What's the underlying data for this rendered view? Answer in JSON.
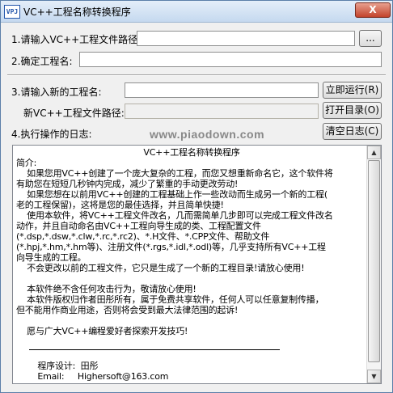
{
  "window": {
    "icon_text": "VPJ",
    "title": "VC++工程名称转换程序",
    "close_label": "X"
  },
  "form": {
    "path_label": "1.请输入VC++工程文件路径:",
    "path_value": "",
    "browse_label": "...",
    "confirm_label": "2.确定工程名:",
    "confirm_value": "",
    "new_name_label": "3.请输入新的工程名:",
    "new_name_value": "",
    "run_label": "立即运行(R)",
    "new_path_label": "新VC++工程文件路径:",
    "new_path_value": "",
    "open_dir_label": "打开目录(O)",
    "log_label": "4.执行操作的日志:",
    "clear_log_label": "清空日志(C)"
  },
  "watermark": "www.piaodown.com",
  "log": {
    "heading": "VC++工程名称转换程序",
    "lines": [
      "简介:",
      "    如果您用VC++创建了一个庞大复杂的工程，而您又想重新命名它，这个软件将",
      "有助您在短短几秒钟内完成，减少了繁重的手动更改劳动!",
      "    如果您想在以前用VC++创建的工程基础上作一些改动而生成另一个新的工程(",
      "老的工程保留)，这将是您的最佳选择，并且简单快捷!",
      "    使用本软件，将VC++工程文件改名，几而需简单几步即可以完成工程文件改名",
      "动作，并且自动命名由VC++工程向导生成的类、工程配置文件",
      "(*.dsp,*.dsw,*.clw,*.rc,*.rc2)、*.H文件、*.CPP文件、帮助文件",
      "(*.hpj,*.hm,*.hm等)、注册文件(*.rgs,*.idl,*.odl)等，几乎支持所有VC++工程",
      "向导生成的工程。",
      "    不会更改以前的工程文件，它只是生成了一个新的工程目录!请放心使用!",
      "",
      "    本软件绝不含任何攻击行为，敬请放心使用!",
      "    本软件版权归作者田彤所有，属于免费共享软件，任何人可以任意复制传播，",
      "但不能用作商业用途，否则将会受到最大法律范围的起诉!",
      "",
      "    愿与广大VC++编程爱好者探索开发技巧!"
    ],
    "designer": "        程序设计:  田彤",
    "email": "        Email:     Highersoft@163.com"
  }
}
